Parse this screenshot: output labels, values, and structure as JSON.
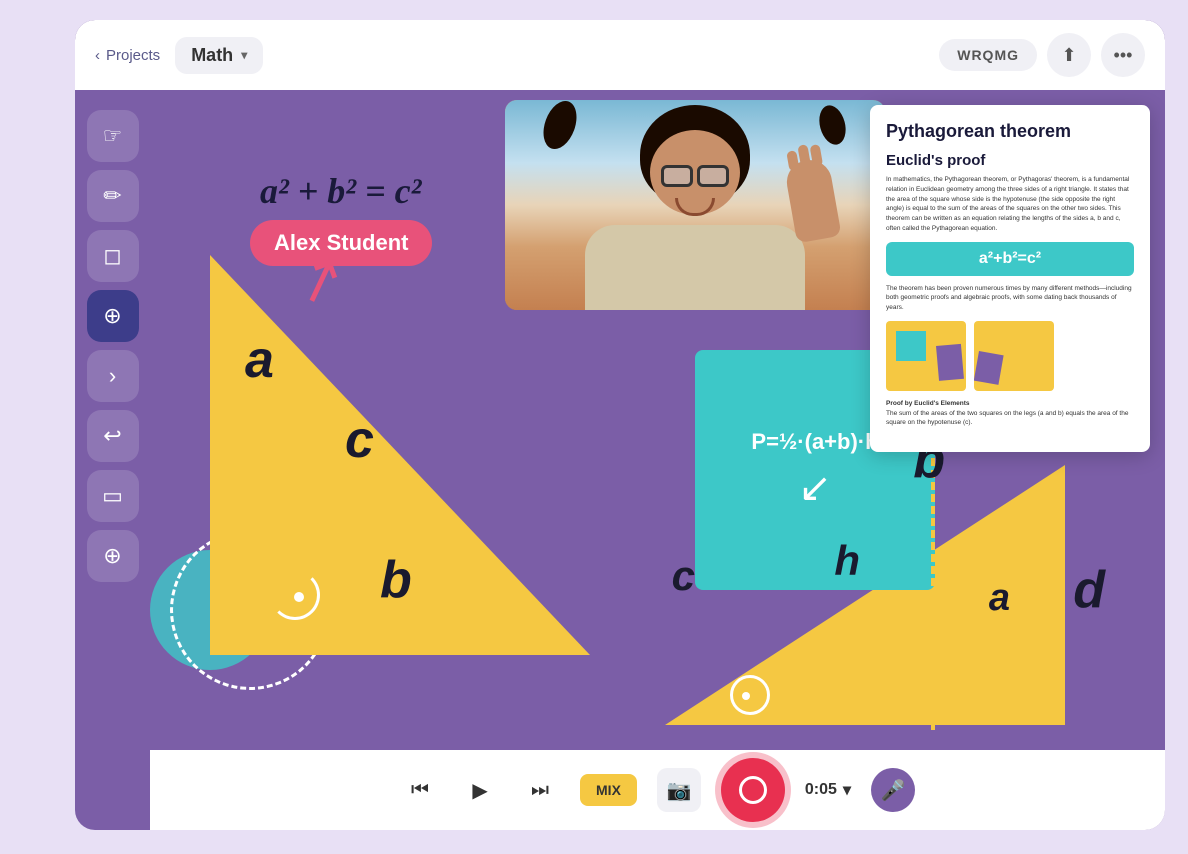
{
  "header": {
    "back_label": "Projects",
    "project_name": "Math",
    "room_code": "WRQMG",
    "share_icon": "↑",
    "more_icon": "•••"
  },
  "toolbar": {
    "tools": [
      {
        "name": "pointer",
        "icon": "☞",
        "active": false
      },
      {
        "name": "pen",
        "icon": "✏",
        "active": false
      },
      {
        "name": "eraser",
        "icon": "⌫",
        "active": false
      },
      {
        "name": "target",
        "icon": "⊕",
        "active": true
      },
      {
        "name": "nav-next",
        "icon": "›",
        "active": false
      },
      {
        "name": "undo",
        "icon": "↩",
        "active": false
      },
      {
        "name": "shape",
        "icon": "▭",
        "active": false
      },
      {
        "name": "zoom",
        "icon": "⊕",
        "active": false
      }
    ]
  },
  "canvas": {
    "formula": "a² + b² = c²",
    "student_name": "Alex Student",
    "teal_formula": "P=½·(a+b)·h",
    "labels": {
      "a_left": "a",
      "b_bottom": "b",
      "c_hyp": "c",
      "c_right": "c",
      "b_right": "b",
      "d": "d",
      "h": "h",
      "a_bottom": "a"
    }
  },
  "document": {
    "title": "Pythagorean theorem",
    "subtitle": "Euclid's proof",
    "body_text": "In mathematics, the Pythagorean theorem, or Pythagoras' theorem, is a fundamental relation in Euclidean geometry among the three sides of a right triangle. It states that the area of the square whose side is the hypotenuse (the side opposite the right angle) is equal to the sum of the areas of the squares on the other two sides. This theorem can be written as an equation relating the lengths of the sides a, b and c, often called the Pythagorean equation.",
    "formula_display": "a²+b²=c²",
    "secondary_text": "The theorem has been proven numerous times by many different methods—including both geometric proofs and algebraic proofs, with some dating back thousands of years.",
    "proof_label": "Proof by Euclid's Elements"
  },
  "bottom_bar": {
    "rewind_label": "⏮",
    "play_label": "▶",
    "fast_forward_label": "⏭",
    "mix_label": "MIX",
    "camera_icon": "📷",
    "timer": "0:05",
    "chevron_down": "▾",
    "mic_muted_icon": "🎤"
  }
}
